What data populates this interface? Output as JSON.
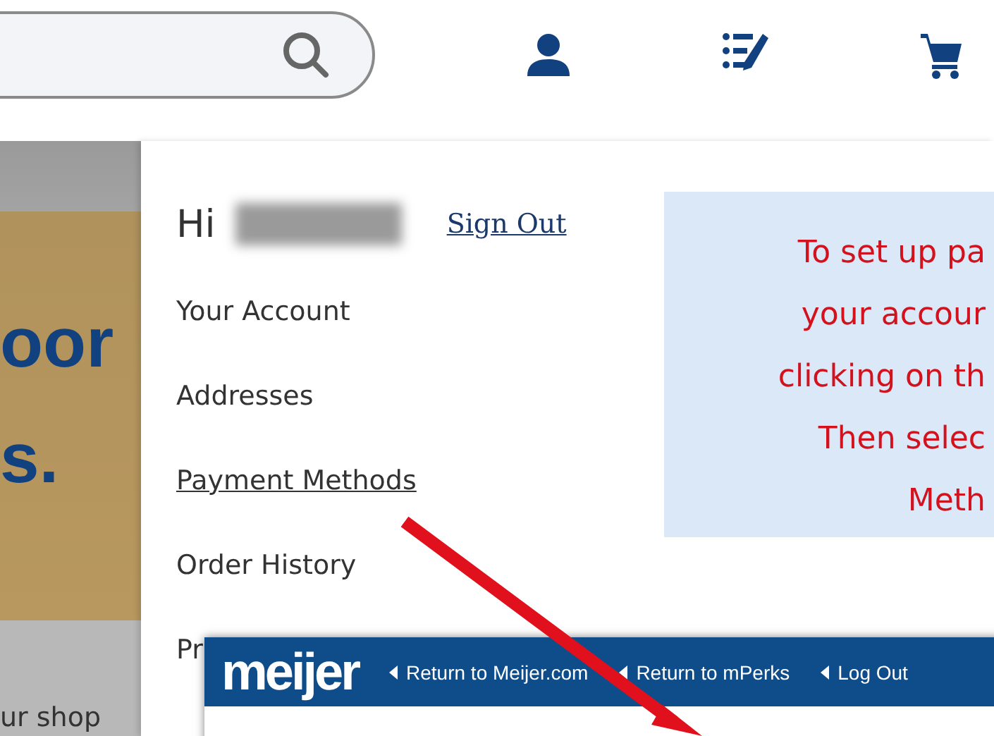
{
  "banner": {
    "texts": [
      "oor",
      "s.",
      "ur shop"
    ]
  },
  "account_menu": {
    "greeting": "Hi",
    "sign_out": "Sign Out",
    "items": [
      {
        "label": "Your Account",
        "underlined": false
      },
      {
        "label": "Addresses",
        "underlined": false
      },
      {
        "label": "Payment Methods",
        "underlined": true
      },
      {
        "label": "Order History",
        "underlined": false
      },
      {
        "label": "Pr",
        "underlined": false
      }
    ]
  },
  "callout": {
    "lines": [
      "To set up pa",
      "your accour",
      "clicking on th",
      "Then selec",
      "Meth"
    ]
  },
  "mperks_bar": {
    "logo": "meijer",
    "links": [
      "Return to Meijer.com",
      "Return to mPerks",
      "Log Out"
    ]
  }
}
